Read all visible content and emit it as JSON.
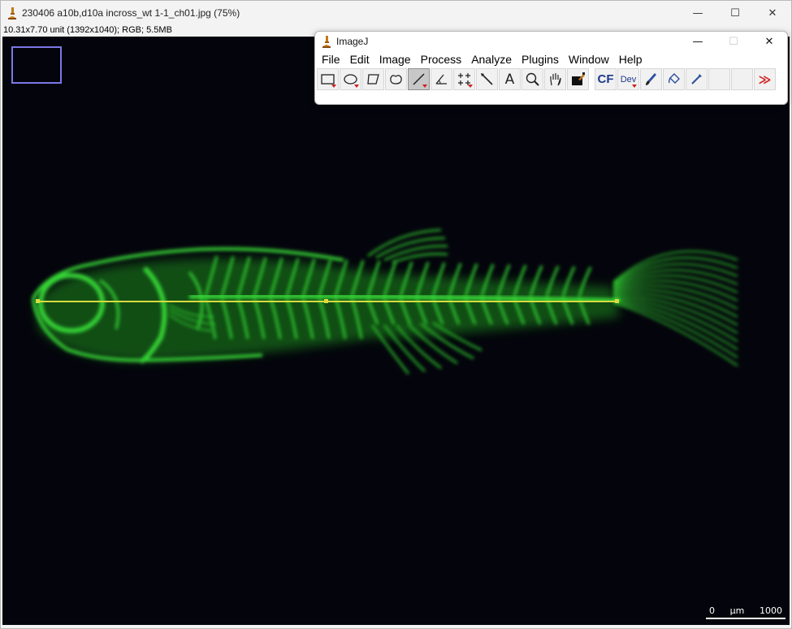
{
  "window": {
    "title": "230406 a10b,d10a incross_wt 1-1_ch01.jpg (75%)",
    "info": "10.31x7.70 unit (1392x1040); RGB; 5.5MB",
    "minimize_glyph": "—",
    "maximize_glyph": "☐",
    "close_glyph": "✕"
  },
  "image": {
    "scalebar_left": "0",
    "scalebar_unit": "µm",
    "scalebar_right": "1000",
    "line_color": "#d8dc40",
    "fluorescence_color": "#2fcf2f"
  },
  "imagej": {
    "title": "ImageJ",
    "minimize_glyph": "—",
    "maximize_glyph": "☐",
    "close_glyph": "✕",
    "menus": [
      "File",
      "Edit",
      "Image",
      "Process",
      "Analyze",
      "Plugins",
      "Window",
      "Help"
    ],
    "tools": {
      "text_label": "A",
      "cf_label": "CF",
      "dev_label": "Dev",
      "more_label": "≫"
    }
  }
}
